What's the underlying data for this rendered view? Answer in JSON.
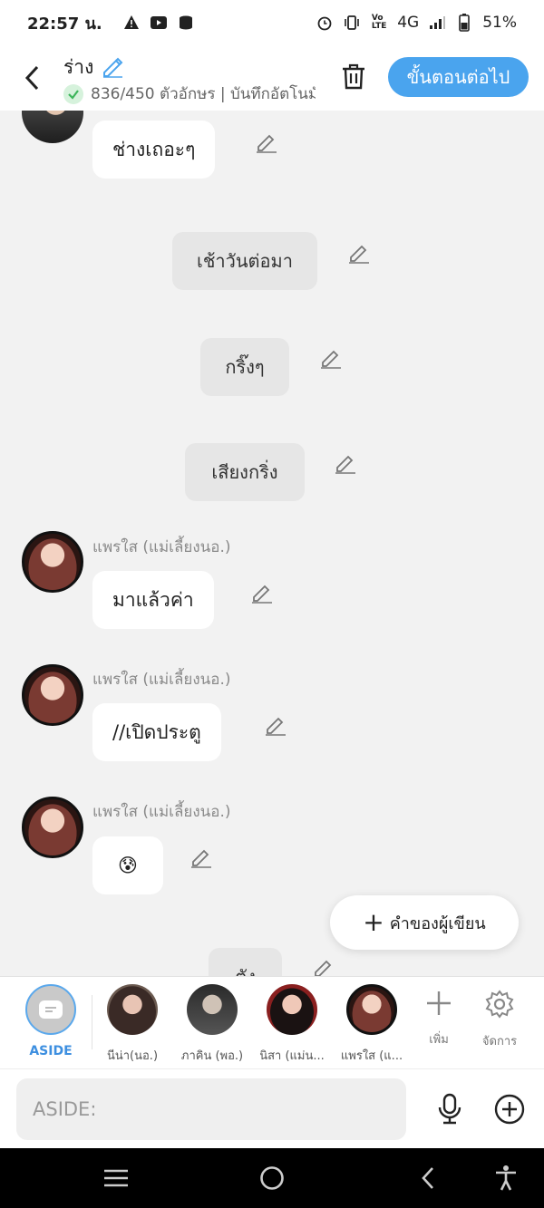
{
  "status_bar": {
    "time": "22:57 น.",
    "battery": "51%",
    "network": "4G"
  },
  "header": {
    "title": "ร่าง",
    "subtitle": "836/450 ตัวอักษร | บันทึกอัตโนมัติ",
    "next_label": "ขั้นตอนต่อไป"
  },
  "chat": {
    "messages": [
      {
        "type": "bubble",
        "text": "ช่างเถอะๆ"
      },
      {
        "type": "narration",
        "text": "เช้าวันต่อมา"
      },
      {
        "type": "narration",
        "text": "กริ๊งๆ"
      },
      {
        "type": "narration",
        "text": "เสียงกริ่ง"
      },
      {
        "type": "bubble",
        "speaker": "แพรใส (แม่เลี้ยงนอ.)",
        "text": "มาแล้วค่า"
      },
      {
        "type": "bubble",
        "speaker": "แพรใส (แม่เลี้ยงนอ.)",
        "text": "//เปิดประตู"
      },
      {
        "type": "bubble",
        "speaker": "แพรใส (แม่เลี้ยงนอ.)",
        "text": "😰"
      },
      {
        "type": "narration",
        "text": "ตัง"
      }
    ],
    "fab_label": "คำของผู้เขียน"
  },
  "characters": {
    "aside_label": "ASIDE",
    "items": [
      {
        "label": "นีน่า(นอ.)"
      },
      {
        "label": "ภาคิน (พอ.)"
      },
      {
        "label": "นิสา (แม่น..."
      },
      {
        "label": "แพรใส (แ..."
      }
    ],
    "add_label": "เพิ่ม",
    "manage_label": "จัดการ"
  },
  "input": {
    "placeholder": "ASIDE:"
  },
  "colors": {
    "accent": "#4aa4ee",
    "background": "#f2f2f2",
    "bubble": "#ffffff",
    "narration": "#e6e6e6"
  }
}
